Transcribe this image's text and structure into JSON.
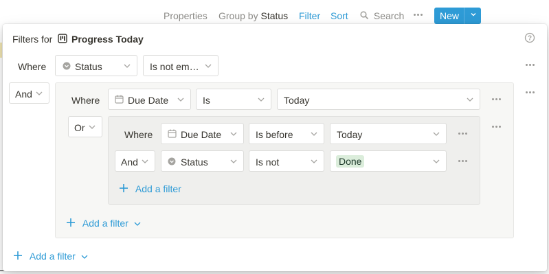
{
  "toolbar": {
    "properties": "Properties",
    "group_by_label": "Group by",
    "group_by_value": "Status",
    "filter": "Filter",
    "sort": "Sort",
    "search": "Search",
    "new": "New"
  },
  "panel": {
    "title_prefix": "Filters for",
    "title": "Progress Today",
    "help_icon": "question-circle-icon"
  },
  "root": {
    "row1": {
      "connector": "Where",
      "property": "Status",
      "operator": "Is not em…"
    },
    "group_connector": "And",
    "group": {
      "row1": {
        "connector": "Where",
        "property": "Due Date",
        "operator": "Is",
        "value": "Today"
      },
      "subgroup_connector": "Or",
      "subgroup": {
        "row1": {
          "connector": "Where",
          "property": "Due Date",
          "operator": "Is before",
          "value": "Today"
        },
        "row2": {
          "connector": "And",
          "property": "Status",
          "operator": "Is not",
          "value": "Done"
        },
        "add_filter": "Add a filter"
      },
      "add_filter": "Add a filter"
    },
    "add_filter": "Add a filter"
  },
  "colors": {
    "accent": "#2e9bd6",
    "tag_done_bg": "#dbeddb"
  }
}
